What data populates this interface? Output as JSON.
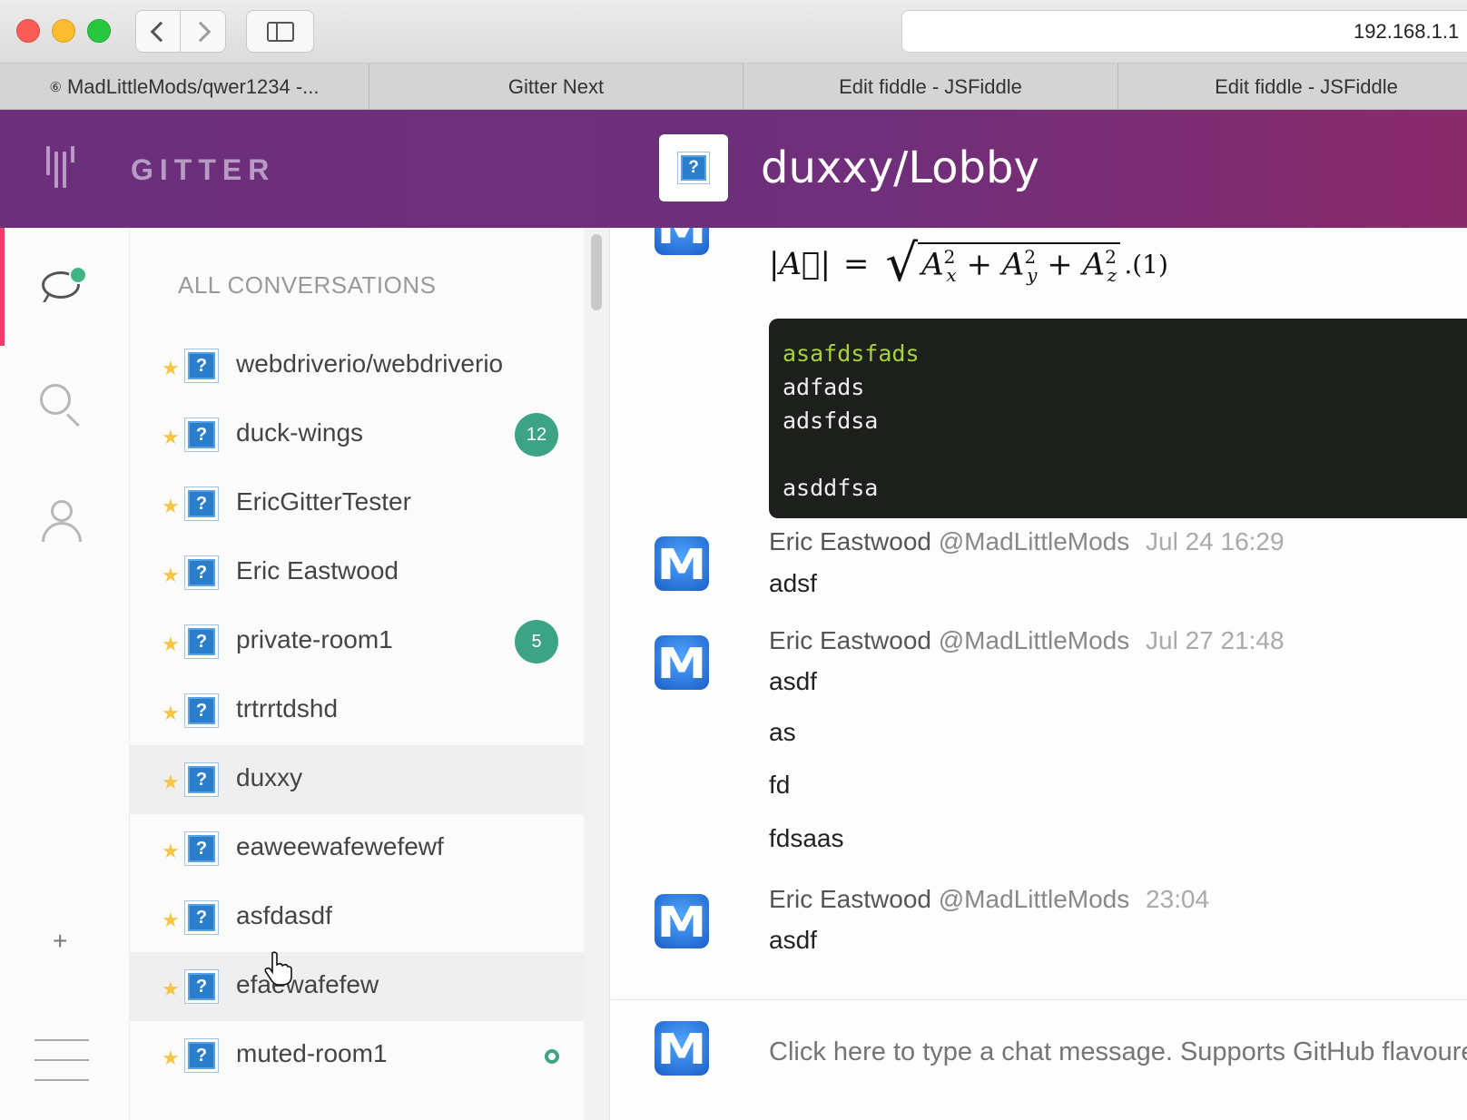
{
  "browser": {
    "url": "192.168.1.1",
    "tabs": [
      {
        "label": "MadLittleMods/qwer1234 -...",
        "icon": "⑥",
        "width": 407
      },
      {
        "label": "Gitter Next",
        "icon": "",
        "width": 412
      },
      {
        "label": "Edit fiddle - JSFiddle",
        "icon": "",
        "width": 413
      },
      {
        "label": "Edit fiddle - JSFiddle",
        "icon": "",
        "width": 415
      }
    ]
  },
  "header": {
    "brand": "GITTER",
    "room_title": "duxxy/Lobby",
    "room_avatar_glyph": "?"
  },
  "rail": {
    "add_label": "+"
  },
  "roomlist": {
    "heading": "ALL CONVERSATIONS",
    "rooms": [
      {
        "name": "webdriverio/webdriverio",
        "badge": "",
        "dot": false,
        "highlight": false
      },
      {
        "name": "duck-wings",
        "badge": "12",
        "dot": false,
        "highlight": false
      },
      {
        "name": "EricGitterTester",
        "badge": "",
        "dot": false,
        "highlight": false
      },
      {
        "name": "Eric Eastwood",
        "badge": "",
        "dot": false,
        "highlight": false
      },
      {
        "name": "private-room1",
        "badge": "5",
        "dot": false,
        "highlight": false
      },
      {
        "name": "trtrrtdshd",
        "badge": "",
        "dot": false,
        "highlight": false
      },
      {
        "name": "duxxy",
        "badge": "",
        "dot": false,
        "highlight": true
      },
      {
        "name": "eaweewafewefewf",
        "badge": "",
        "dot": false,
        "highlight": false
      },
      {
        "name": "asfdasdf",
        "badge": "",
        "dot": false,
        "highlight": false
      },
      {
        "name": "efaewafefew",
        "badge": "",
        "dot": false,
        "highlight": true
      },
      {
        "name": "muted-room1",
        "badge": "",
        "dot": true,
        "highlight": false
      }
    ]
  },
  "chat": {
    "code_lines": [
      "asafdsfads",
      "adfads",
      "adsfdsa",
      "",
      "asddfsa"
    ],
    "messages": [
      {
        "author": "Eric Eastwood",
        "handle": "@MadLittleMods",
        "time": "Jul 24 16:29",
        "lines": [
          "adsf"
        ]
      },
      {
        "author": "Eric Eastwood",
        "handle": "@MadLittleMods",
        "time": "Jul 27 21:48",
        "lines": [
          "asdf",
          "as",
          "fd",
          "fdsaas"
        ]
      },
      {
        "author": "Eric Eastwood",
        "handle": "@MadLittleMods",
        "time": "23:04",
        "lines": [
          "asdf"
        ]
      }
    ],
    "composer_placeholder": "Click here to type a chat message. Supports GitHub flavoured markdown."
  }
}
